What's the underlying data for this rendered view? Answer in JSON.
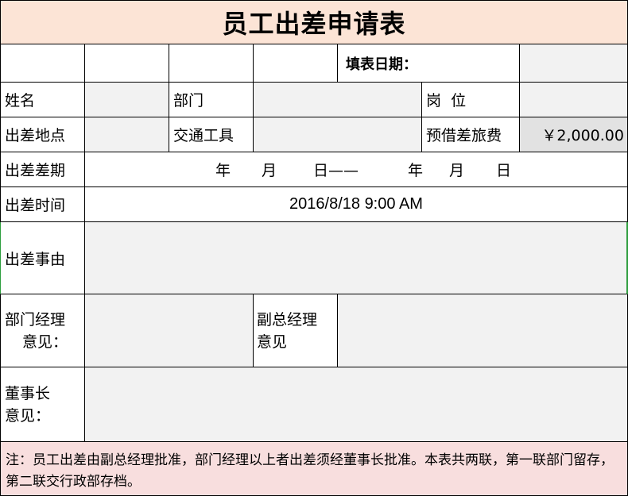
{
  "form": {
    "title": "员工出差申请表",
    "fill_date_label": "填表日期：",
    "name_label": "姓名",
    "dept_label": "部门",
    "position_label": "岗  位",
    "location_label": "出差地点",
    "transport_label": "交通工具",
    "advance_label": "预借差旅费",
    "advance_value": "￥2,000.00",
    "period_label": "出差差期",
    "period_text": {
      "year1": "年",
      "month1": "月",
      "day1": "日——",
      "year2": "年",
      "month2": "月",
      "day2": "日"
    },
    "time_label": "出差时间",
    "time_value": "2016/8/18 9:00 AM",
    "reason_label": "出差事由",
    "dept_manager_label_1": "部门经理",
    "dept_manager_label_2": "意见：",
    "vice_manager_label_1": "副总经理",
    "vice_manager_label_2": "意见",
    "chairman_label_1": "董事长",
    "chairman_label_2": "意见：",
    "note_text": "注：员工出差由副总经理批准，部门经理以上者出差须经董事长批准。本表共两联，第一联部门留存，第二联交行政部存档。"
  },
  "colors": {
    "title_bg": "#fce4d6",
    "note_bg": "#f8dede",
    "input_bg": "#f2f2f2",
    "advance_bg": "#e2e2e2"
  }
}
